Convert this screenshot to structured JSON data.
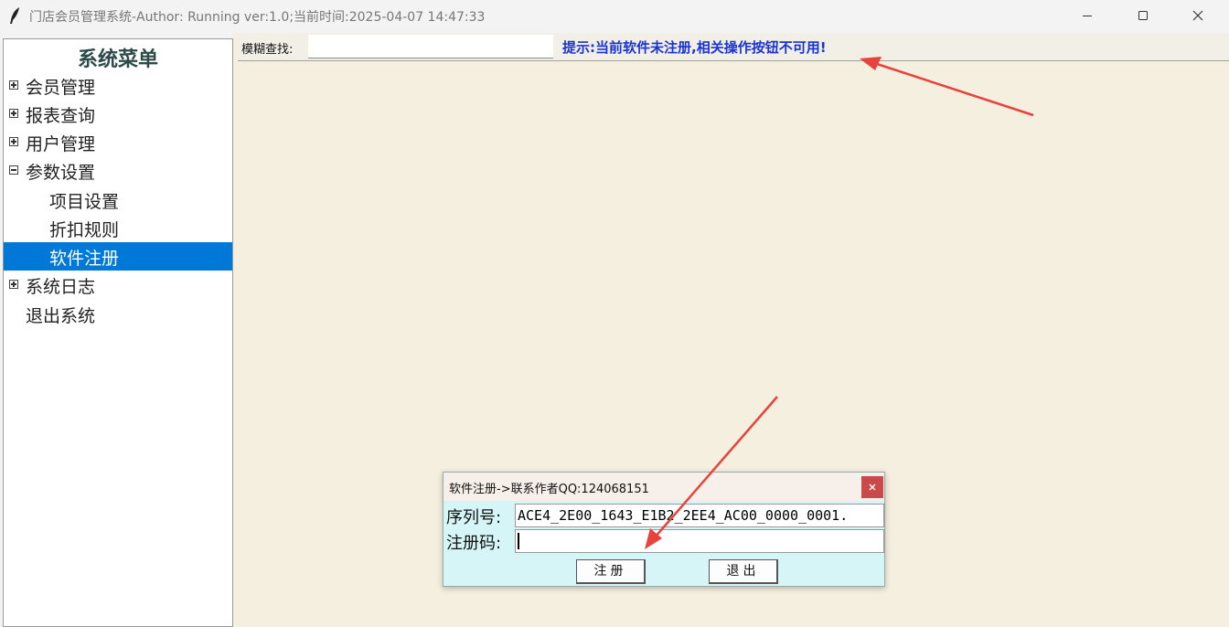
{
  "window": {
    "title": "门店会员管理系统-Author: Running  ver:1.0;当前时间:2025-04-07 14:47:33"
  },
  "sidebar": {
    "title": "系统菜单",
    "items": [
      {
        "label": "会员管理",
        "state": "collapsed"
      },
      {
        "label": "报表查询",
        "state": "collapsed"
      },
      {
        "label": "用户管理",
        "state": "collapsed"
      },
      {
        "label": "参数设置",
        "state": "expanded"
      },
      {
        "label": "项目设置"
      },
      {
        "label": "折扣规则"
      },
      {
        "label": "软件注册",
        "selected": true
      },
      {
        "label": "系统日志",
        "state": "collapsed"
      },
      {
        "label": "退出系统"
      }
    ]
  },
  "toolbar": {
    "search_label": "模糊查找:",
    "search_value": "",
    "notice": "提示:当前软件未注册,相关操作按钮不可用!"
  },
  "dialog": {
    "title": "软件注册->联系作者QQ:124068151",
    "serial_label": "序列号:",
    "serial_value": "ACE4_2E00_1643_E1B2_2EE4_AC00_0000_0001.",
    "code_label": "注册码:",
    "code_value": "",
    "register_button": "注册",
    "exit_button": "退出"
  },
  "colors": {
    "selection": "#0078d7",
    "notice": "#1a33d6",
    "dialog_bg": "#d5f5f6",
    "close_button": "#c94a4a",
    "main_bg": "#f5efe0",
    "annotation_arrow": "#e8423c"
  }
}
